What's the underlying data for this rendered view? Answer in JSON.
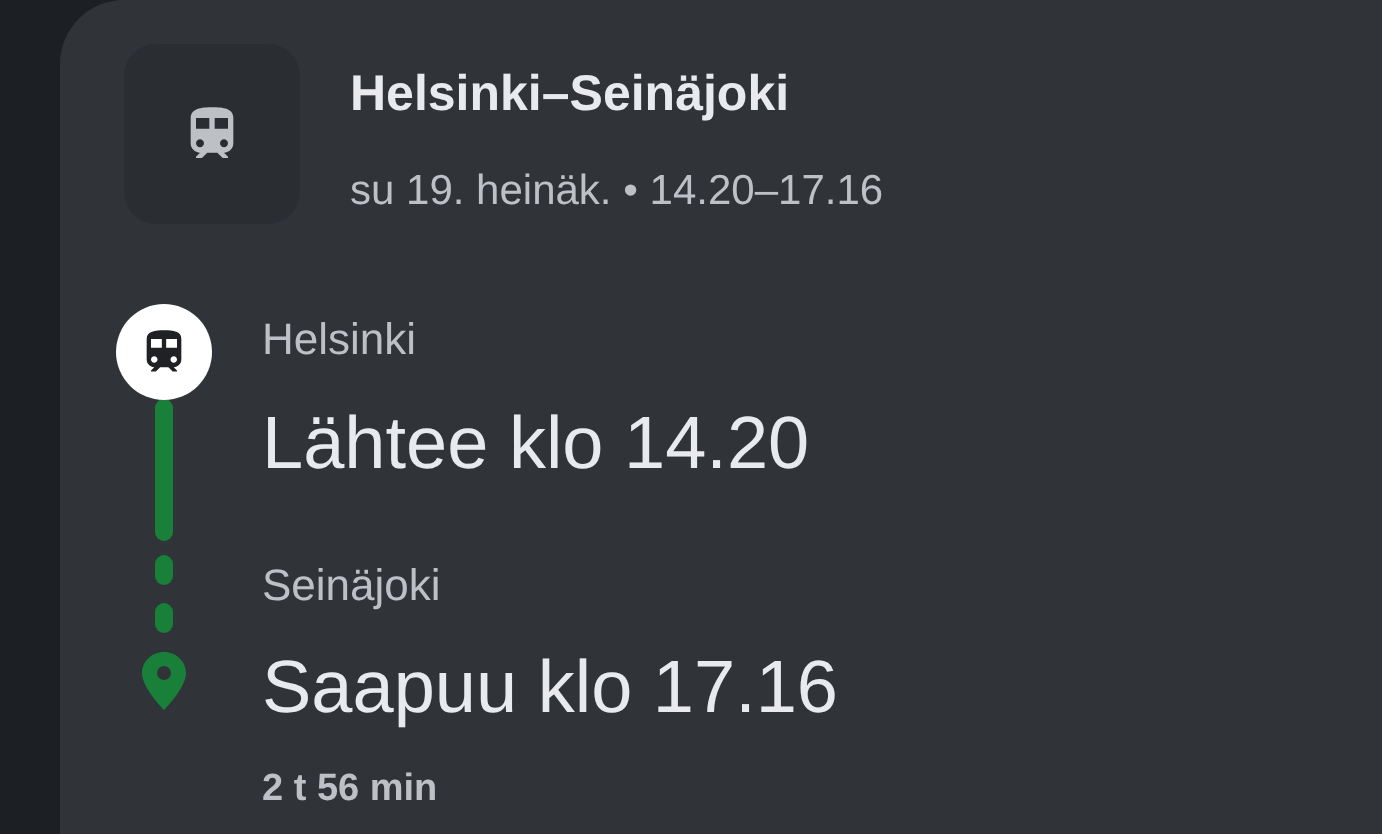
{
  "trip": {
    "title": "Helsinki–Seinäjoki",
    "subtitle": "su 19. heinäk. • 14.20–17.16"
  },
  "stops": [
    {
      "kind": "departure",
      "station": "Helsinki",
      "time": "Lähtee klo 14.20"
    },
    {
      "kind": "arrival",
      "station": "Seinäjoki",
      "time": "Saapuu klo 17.16"
    }
  ],
  "duration": "2 t 56 min"
}
